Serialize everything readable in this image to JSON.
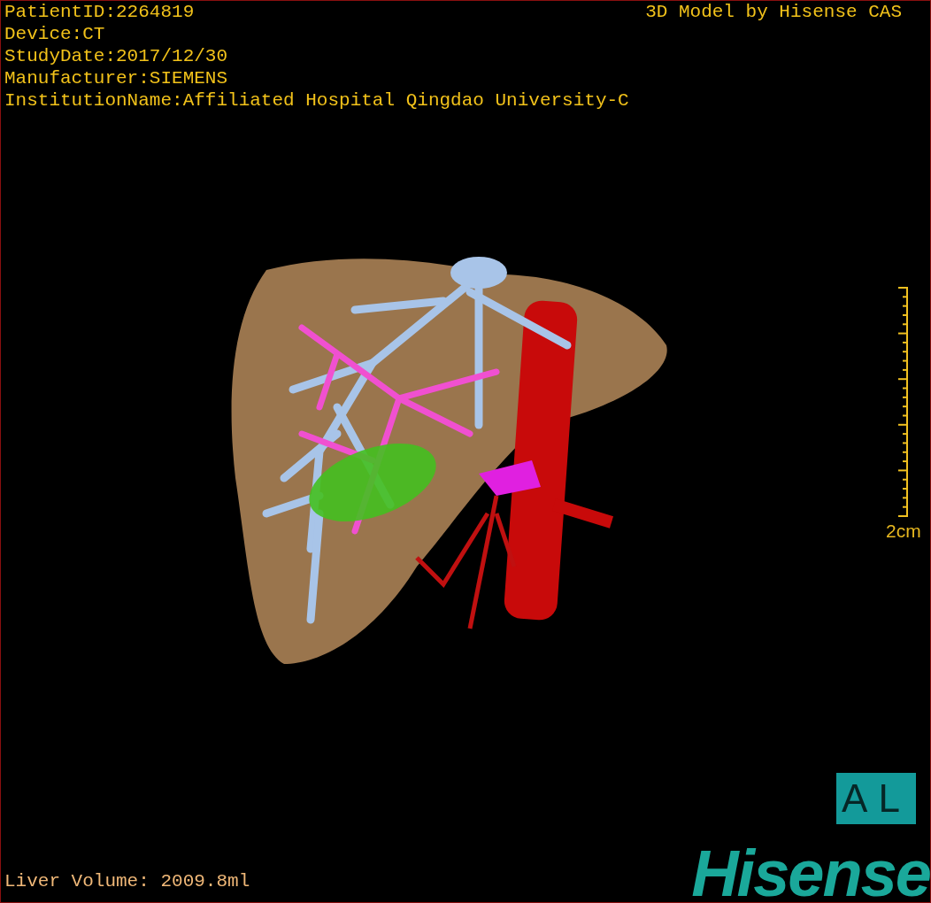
{
  "header": {
    "info_lines": [
      "PatientID:2264819",
      "Device:CT",
      "StudyDate:2017/12/30",
      "Manufacturer:SIEMENS",
      "InstitutionName:Affiliated Hospital Qingdao University-C"
    ],
    "title": "3D Model by Hisense CAS"
  },
  "scale": {
    "label": "2cm"
  },
  "orientation_badge": "AL",
  "footer": {
    "liver_volume": "Liver Volume: 2009.8ml",
    "logo": "Hisense"
  }
}
